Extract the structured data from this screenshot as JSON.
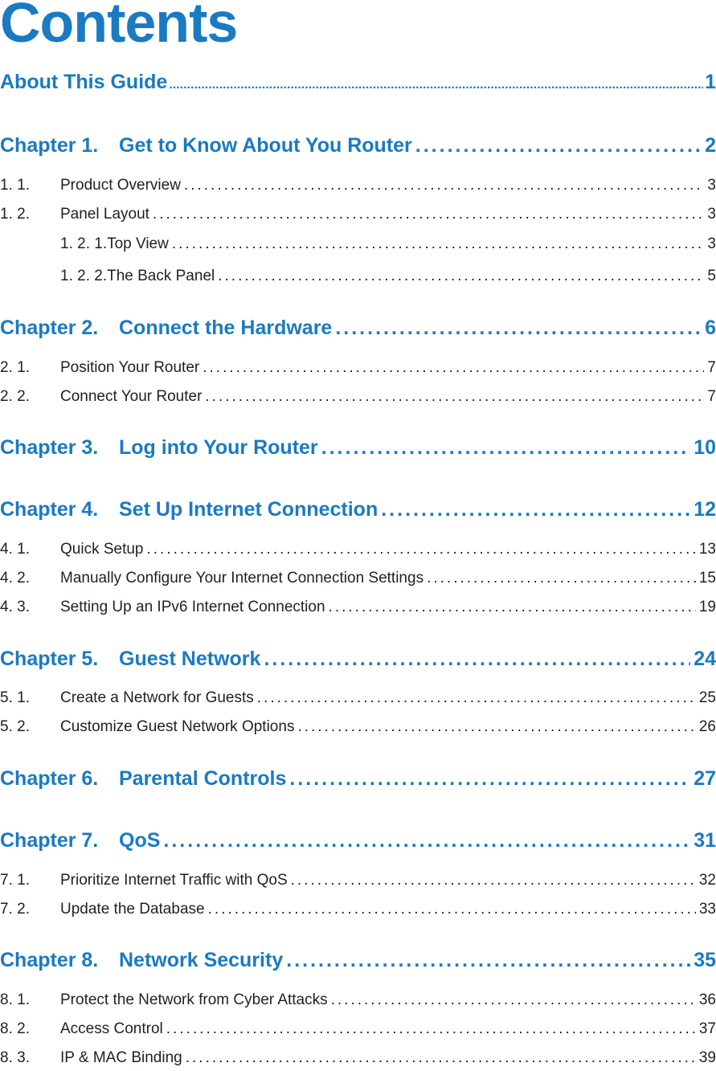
{
  "heading": "Contents",
  "accent_color": "#1a7ac2",
  "entries": [
    {
      "level": "about",
      "number": "",
      "title": "About This Guide",
      "page": "1"
    },
    {
      "level": "chapter",
      "number": "Chapter 1.",
      "title": "Get to Know About You Router",
      "page": "2"
    },
    {
      "level": "section",
      "number": "1. 1.",
      "title": "Product Overview",
      "page": "3"
    },
    {
      "level": "section",
      "number": "1. 2.",
      "title": "Panel Layout",
      "page": "3"
    },
    {
      "level": "subsection",
      "number": "",
      "title": "1. 2. 1.Top View",
      "page": "3"
    },
    {
      "level": "subsection",
      "number": "",
      "title": "1. 2. 2.The Back Panel",
      "page": "5"
    },
    {
      "level": "chapter",
      "number": "Chapter 2.",
      "title": "Connect the Hardware",
      "page": "6"
    },
    {
      "level": "section",
      "number": "2. 1.",
      "title": "Position Your Router",
      "page": "7"
    },
    {
      "level": "section",
      "number": "2. 2.",
      "title": "Connect Your Router",
      "page": "7"
    },
    {
      "level": "chapter",
      "number": "Chapter 3.",
      "title": "Log into Your Router",
      "page": "10"
    },
    {
      "level": "chapter",
      "number": "Chapter 4.",
      "title": "Set Up Internet Connection",
      "page": "12"
    },
    {
      "level": "section",
      "number": "4. 1.",
      "title": "Quick Setup",
      "page": "13"
    },
    {
      "level": "section",
      "number": "4. 2.",
      "title": "Manually Configure Your Internet Connection Settings",
      "page": "15"
    },
    {
      "level": "section",
      "number": "4. 3.",
      "title": "Setting Up an IPv6 Internet Connection",
      "page": "19"
    },
    {
      "level": "chapter",
      "number": "Chapter 5.",
      "title": "Guest Network",
      "page": "24"
    },
    {
      "level": "section",
      "number": "5. 1.",
      "title": "Create a Network for Guests",
      "page": "25"
    },
    {
      "level": "section",
      "number": "5. 2.",
      "title": "Customize Guest Network Options",
      "page": "26"
    },
    {
      "level": "chapter",
      "number": "Chapter 6.",
      "title": "Parental Controls",
      "page": "27"
    },
    {
      "level": "chapter",
      "number": "Chapter 7.",
      "title": "QoS",
      "page": "31"
    },
    {
      "level": "section",
      "number": "7. 1.",
      "title": "Prioritize Internet Traffic with QoS",
      "page": "32"
    },
    {
      "level": "section",
      "number": "7. 2.",
      "title": "Update the Database",
      "page": "33"
    },
    {
      "level": "chapter",
      "number": "Chapter 8.",
      "title": "Network Security",
      "page": "35"
    },
    {
      "level": "section",
      "number": "8. 1.",
      "title": "Protect the Network from Cyber Attacks",
      "page": "36"
    },
    {
      "level": "section",
      "number": "8. 2.",
      "title": "Access Control",
      "page": "37"
    },
    {
      "level": "section",
      "number": "8. 3.",
      "title": "IP & MAC Binding",
      "page": "39"
    }
  ]
}
